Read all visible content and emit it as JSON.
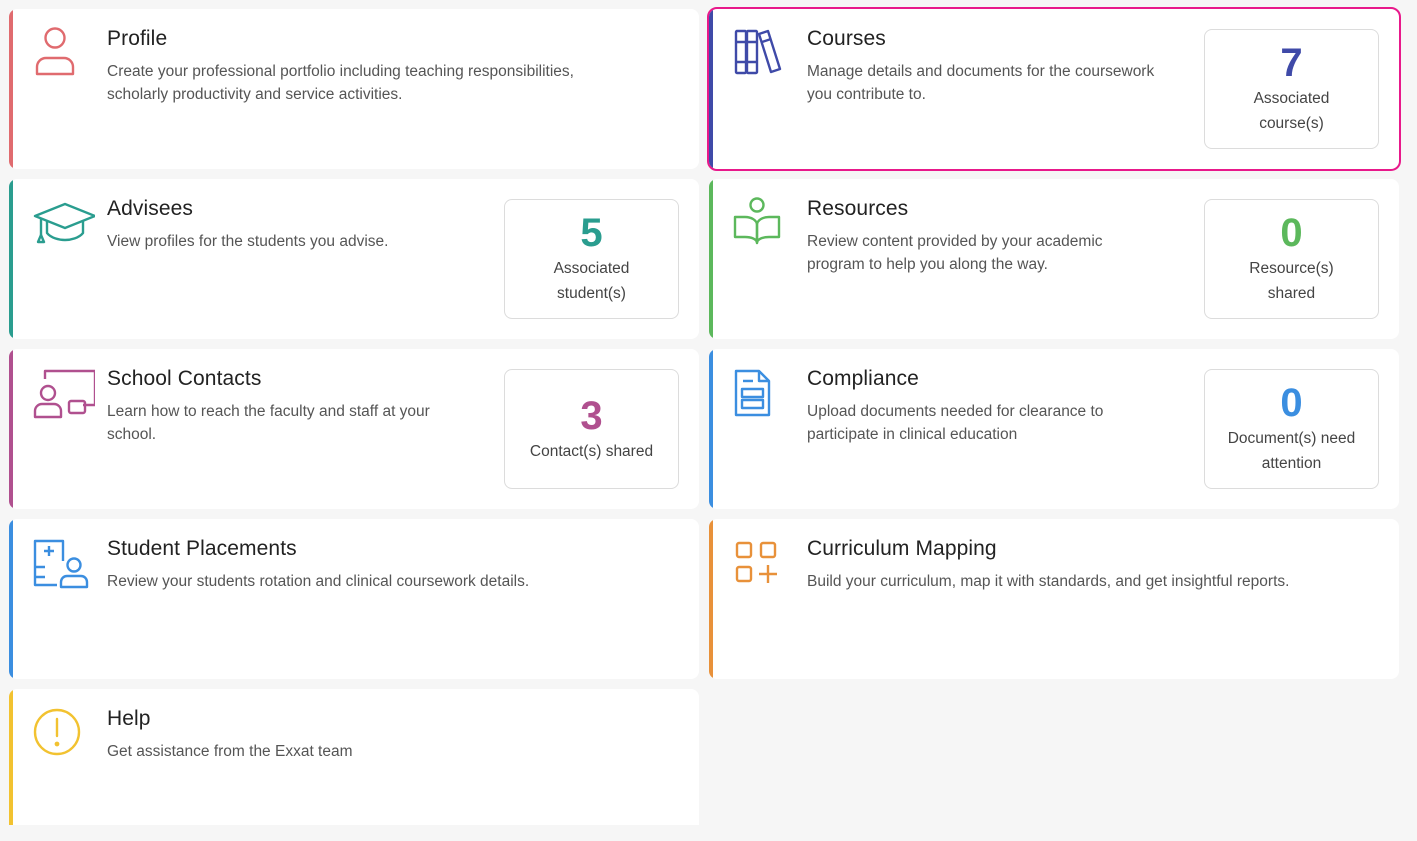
{
  "colors": {
    "profile": "#e06b6f",
    "courses": "#3f4aa8",
    "advisees": "#2a9d8f",
    "resources": "#5cb85c",
    "contacts": "#b0508f",
    "compliance": "#3b8ee0",
    "placements": "#3b8ee0",
    "curriculum": "#e8913a",
    "help": "#f2c230",
    "selection_outline": "#e8198b"
  },
  "cards": {
    "profile": {
      "icon": "person-icon",
      "title": "Profile",
      "desc_line1": "Create your professional portfolio including teaching responsibilities,",
      "desc_line2": "scholarly productivity and service activities."
    },
    "courses": {
      "icon": "books-icon",
      "title": "Courses",
      "desc_line1": "Manage details and documents for the coursework",
      "desc_line2": "you contribute to.",
      "stat_value": "7",
      "stat_line1": "Associated",
      "stat_line2": "course(s)",
      "selected": true
    },
    "advisees": {
      "icon": "graduation-cap-icon",
      "title": "Advisees",
      "desc_line1": "View profiles for the students you advise.",
      "stat_value": "5",
      "stat_line1": "Associated",
      "stat_line2": "student(s)"
    },
    "resources": {
      "icon": "reader-book-icon",
      "title": "Resources",
      "desc_line1": "Review content provided by your academic",
      "desc_line2": "program to help you along the way.",
      "stat_value": "0",
      "stat_line1": "Resource(s)",
      "stat_line2": "shared"
    },
    "contacts": {
      "icon": "contact-board-icon",
      "title": "School Contacts",
      "desc_line1": "Learn how to reach the faculty and staff at your",
      "desc_line2": "school.",
      "stat_value": "3",
      "stat_line1": "Contact(s) shared"
    },
    "compliance": {
      "icon": "document-icon",
      "title": "Compliance",
      "desc_line1": "Upload documents needed for clearance to",
      "desc_line2": "participate in clinical education",
      "stat_value": "0",
      "stat_line1": "Document(s) need",
      "stat_line2": "attention"
    },
    "placements": {
      "icon": "clipboard-user-icon",
      "title": "Student Placements",
      "desc_line1": "Review your students rotation and clinical coursework details."
    },
    "curriculum": {
      "icon": "grid-plus-icon",
      "title": "Curriculum Mapping",
      "desc_line1": "Build your curriculum, map it with standards, and get insightful reports."
    },
    "help": {
      "icon": "alert-circle-icon",
      "title": "Help",
      "desc_line1": "Get assistance from the Exxat team"
    }
  }
}
